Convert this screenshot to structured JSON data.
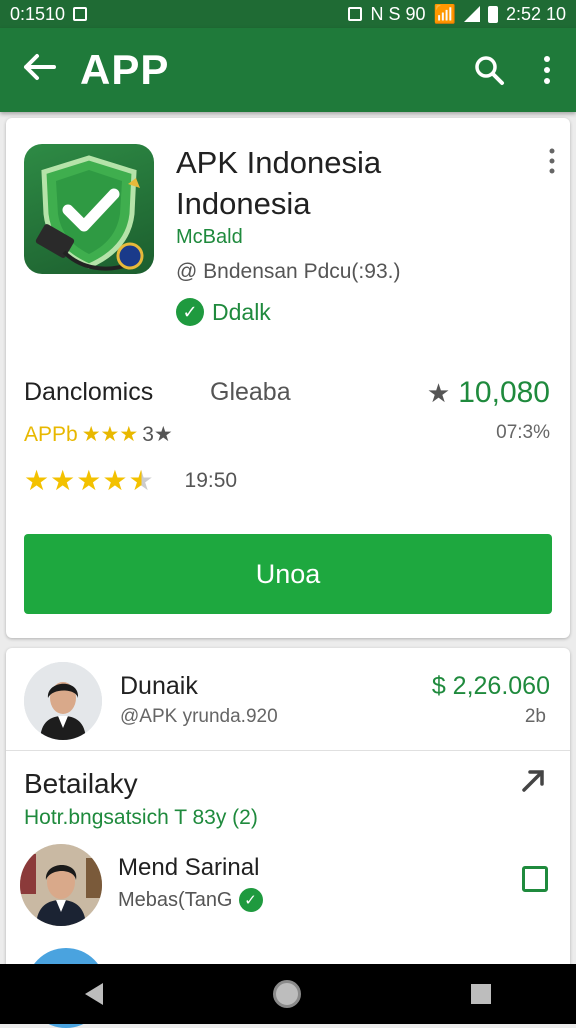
{
  "status_bar": {
    "time_left": "0:1510",
    "signal_text": "N S 90",
    "time_right": "2:52 10"
  },
  "app_bar": {
    "title": "APP",
    "back_icon": "arrow-left-icon",
    "search_icon": "search-icon",
    "menu_icon": "more-vert-icon"
  },
  "app_card": {
    "name": "APK Indonesia Indonesia",
    "developer": "McBald",
    "subtitle": "@ Bndensan Pdcu(:93.)",
    "verified_label": "Ddalk",
    "stats": {
      "downloads_label": "Danclomics",
      "category": "Gleaba",
      "rating_count": "10,080",
      "badge_text": "APPb",
      "badge_stars": "★★★",
      "badge_tail": "3★",
      "percent": "07:3%",
      "stars": 4.5,
      "rating_value": "19:50"
    },
    "install_label": "Unoa"
  },
  "feed": {
    "user1": {
      "name": "Dunaik",
      "handle": "@APK yrunda.920",
      "amount": "$ 2,26.060",
      "time": "2b"
    },
    "section": {
      "title": "Betailaky",
      "subtitle": "Hotr.bngsatsich T 83y (2)"
    },
    "user2": {
      "name": "Mend Sarinal",
      "subtitle": "Mebas(TanG"
    }
  },
  "colors": {
    "brand_green": "#1f7a3a",
    "install_green": "#1ea83f",
    "accent_green": "#1f8a3d",
    "star_yellow": "#f3c100"
  }
}
